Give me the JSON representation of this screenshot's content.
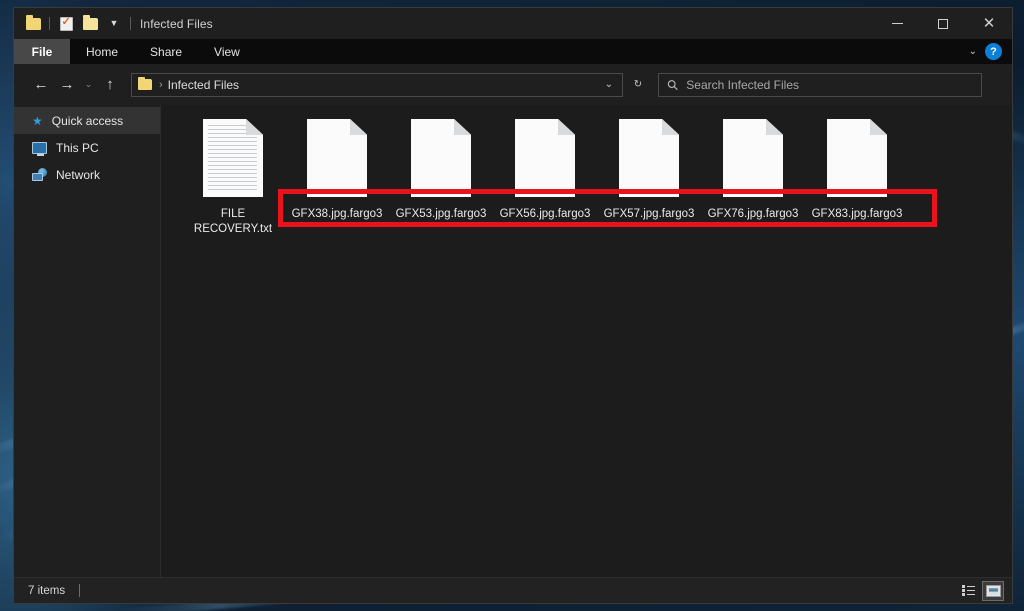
{
  "window": {
    "title": "Infected Files",
    "quick_access_toolbar": [
      {
        "name": "folder-icon",
        "label": ""
      },
      {
        "name": "properties-icon",
        "label": ""
      },
      {
        "name": "new-folder-icon",
        "label": ""
      },
      {
        "name": "chevron-down-icon",
        "label": "▾"
      }
    ],
    "controls": {
      "minimize": "—",
      "maximize": "□",
      "close": "✕"
    }
  },
  "ribbon": {
    "tabs": [
      {
        "label": "File",
        "active": true
      },
      {
        "label": "Home",
        "active": false
      },
      {
        "label": "Share",
        "active": false
      },
      {
        "label": "View",
        "active": false
      }
    ],
    "expand_icon": "⌄",
    "help_label": "?"
  },
  "navbar": {
    "back_icon": "←",
    "forward_icon": "→",
    "recent_icon": "⌄",
    "up_icon": "↑",
    "breadcrumb_separator": "›",
    "breadcrumb": "Infected Files",
    "address_dropdown_icon": "⌄",
    "refresh_icon": "↻"
  },
  "search": {
    "placeholder": "Search Infected Files",
    "value": "",
    "icon": "search-icon"
  },
  "sidebar": {
    "items": [
      {
        "label": "Quick access",
        "icon": "star-icon",
        "active": true
      },
      {
        "label": "This PC",
        "icon": "computer-icon",
        "active": false
      },
      {
        "label": "Network",
        "icon": "network-icon",
        "active": false
      }
    ]
  },
  "files": [
    {
      "name": "FILE RECOVERY.txt",
      "line1": "FILE",
      "line2": "RECOVERY.txt",
      "type": "text",
      "encrypted": false
    },
    {
      "name": "GFX38.jpg.fargo3",
      "line1": "GFX38.jpg.fargo3",
      "line2": "",
      "type": "blank",
      "encrypted": true
    },
    {
      "name": "GFX53.jpg.fargo3",
      "line1": "GFX53.jpg.fargo3",
      "line2": "",
      "type": "blank",
      "encrypted": true
    },
    {
      "name": "GFX56.jpg.fargo3",
      "line1": "GFX56.jpg.fargo3",
      "line2": "",
      "type": "blank",
      "encrypted": true
    },
    {
      "name": "GFX57.jpg.fargo3",
      "line1": "GFX57.jpg.fargo3",
      "line2": "",
      "type": "blank",
      "encrypted": true
    },
    {
      "name": "GFX76.jpg.fargo3",
      "line1": "GFX76.jpg.fargo3",
      "line2": "",
      "type": "blank",
      "encrypted": true
    },
    {
      "name": "GFX83.jpg.fargo3",
      "line1": "GFX83.jpg.fargo3",
      "line2": "",
      "type": "blank",
      "encrypted": true
    }
  ],
  "annotation": {
    "color": "#e8131c",
    "description": "red rectangle highlighting encrypted .fargo3 files"
  },
  "statusbar": {
    "item_count": "7 items",
    "view_details_icon": "details-view-icon",
    "view_tiles_icon": "large-icons-view-icon"
  },
  "colors": {
    "window_background": "#1f1f1f",
    "content_background": "#1c1c1c",
    "accent": "#0c7fd8",
    "annotation": "#e8131c"
  }
}
